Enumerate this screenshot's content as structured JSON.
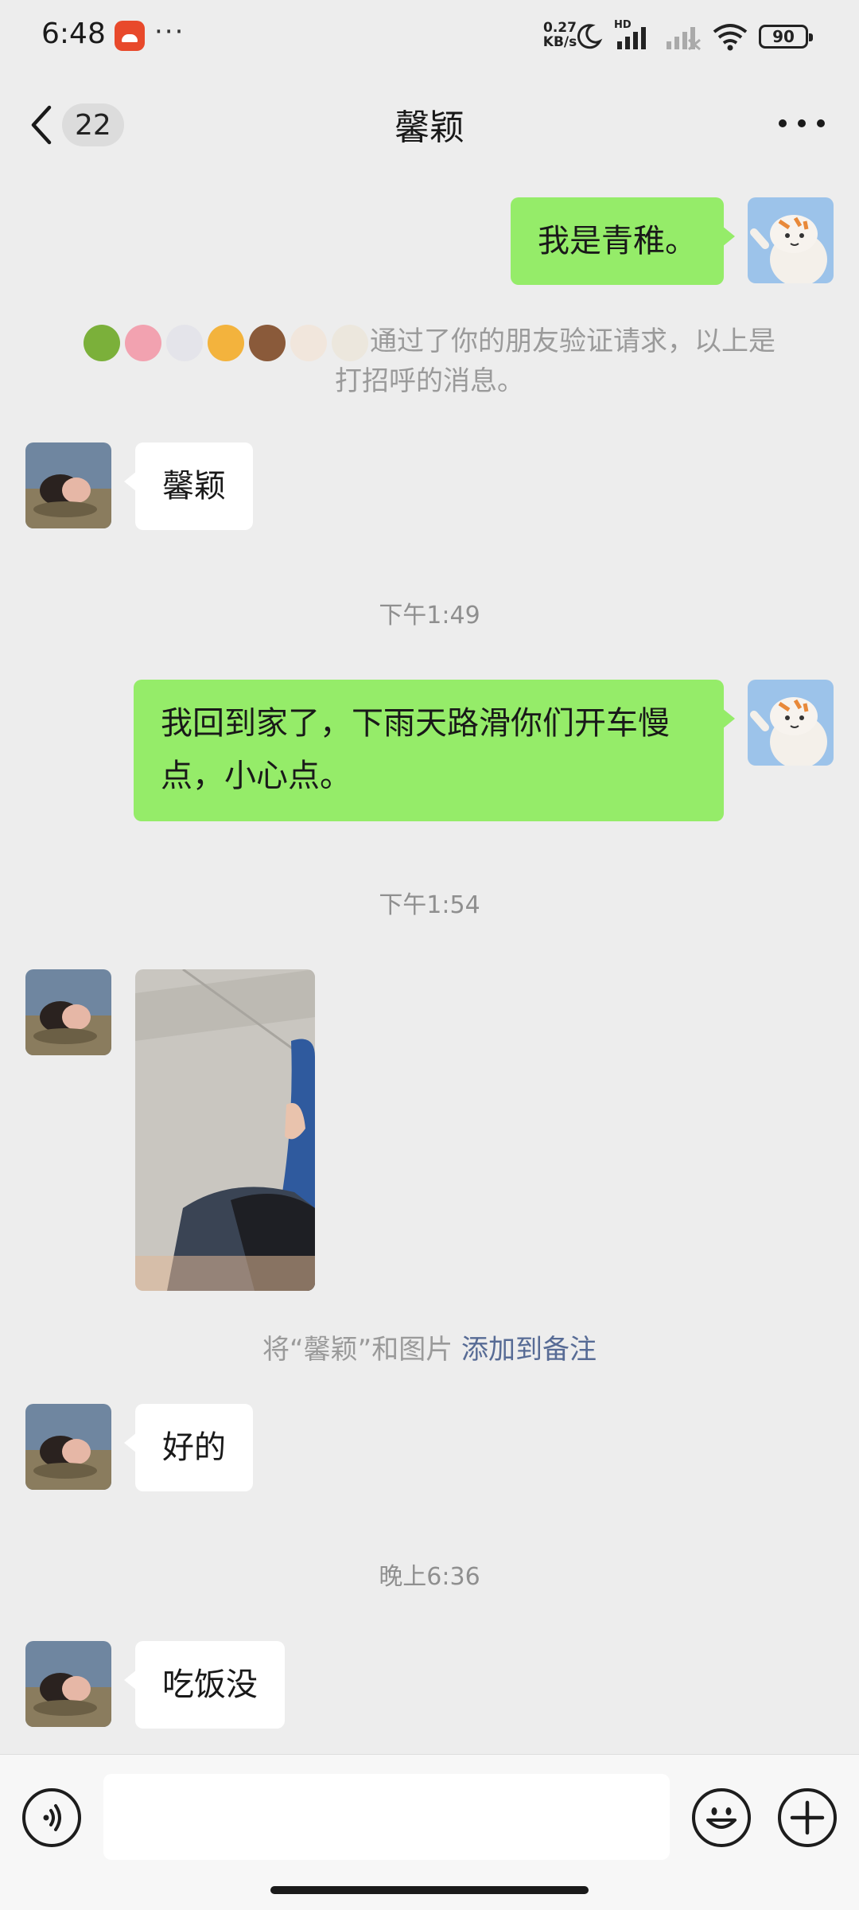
{
  "status_bar": {
    "time": "6:48",
    "more": "···",
    "net_speed_value": "0.27",
    "net_speed_unit": "KB/s",
    "signal_label": "HD",
    "battery": "90"
  },
  "header": {
    "back_badge": "22",
    "title": "馨颖"
  },
  "messages": {
    "m1_text": "我是青稚。",
    "system_text": "通过了你的朋友验证请求，以上是打招呼的消息。",
    "m2_text": "馨颖",
    "time1": "下午1:49",
    "m3_text": "我回到家了，下雨天路滑你们开车慢点，小心点。",
    "time2": "下午1:54",
    "remark_prefix": "将“馨颖”和图片",
    "remark_link": "添加到备注",
    "m4_text": "好的",
    "time3": "晚上6:36",
    "m5_text": "吃饭没"
  },
  "emojis": [
    "snake-emoji",
    "pig-emoji",
    "rabbit-emoji",
    "tiger-emoji",
    "horse-emoji",
    "cow-emoji",
    "goat-emoji"
  ],
  "input": {
    "value": ""
  },
  "colors": {
    "self_bubble": "#95ec69",
    "other_bubble": "#ffffff",
    "background": "#ededed",
    "link": "#576b95"
  }
}
